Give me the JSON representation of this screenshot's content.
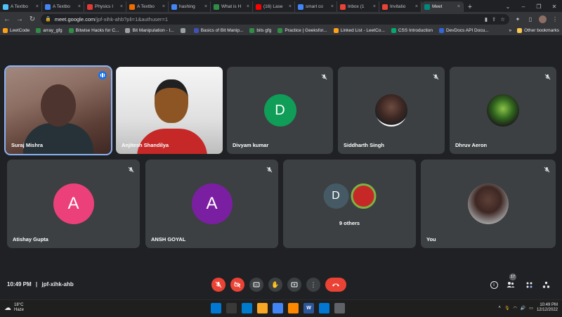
{
  "browser": {
    "tabs": [
      {
        "label": "A Textbo",
        "color": "#4fc3f7"
      },
      {
        "label": "A Textbo",
        "color": "#4285f4"
      },
      {
        "label": "Physics I",
        "color": "#e53935"
      },
      {
        "label": "A Textbo",
        "color": "#ef6c00"
      },
      {
        "label": "hashing",
        "color": "#4285f4"
      },
      {
        "label": "What is H",
        "color": "#2f8d46"
      },
      {
        "label": "(16) Lase",
        "color": "#ff0000"
      },
      {
        "label": "smart co",
        "color": "#4285f4"
      },
      {
        "label": "Inbox (1",
        "color": "#ea4335"
      },
      {
        "label": "Invitatio",
        "color": "#ea4335"
      },
      {
        "label": "Meet",
        "color": "#00897b"
      }
    ],
    "new_tab": "+",
    "window_controls": [
      "⌄",
      "–",
      "❐",
      "✕"
    ],
    "address": {
      "host": "meet.google.com",
      "path": "/jpf-xihk-ahb?pli=1&authuser=1"
    },
    "bookmarks": [
      {
        "label": "LeetCode",
        "color": "#ffa116"
      },
      {
        "label": "array_gfg",
        "color": "#2f8d46"
      },
      {
        "label": "Bitwise Hacks for C...",
        "color": "#2f8d46"
      },
      {
        "label": "Bit Manipulation - I...",
        "color": "#9aa0a6"
      },
      {
        "label": "",
        "color": "#9aa0a6"
      },
      {
        "label": "Basics of Bit Manip...",
        "color": "#3f51b5"
      },
      {
        "label": "bits gfg",
        "color": "#2f8d46"
      },
      {
        "label": "Practice | Geeksfor...",
        "color": "#2f8d46"
      },
      {
        "label": "Linked List - LeetCo...",
        "color": "#ffa116"
      },
      {
        "label": "CSS Introduction",
        "color": "#04aa6d"
      },
      {
        "label": "DevDocs API Docu...",
        "color": "#3367d6"
      }
    ],
    "bookmarks_more": "»",
    "other_bookmarks": "Other bookmarks"
  },
  "meet": {
    "participants": [
      {
        "name": "Suraj Mishra",
        "type": "video",
        "speaking": true
      },
      {
        "name": "Anjitesh Shandilya",
        "type": "video"
      },
      {
        "name": "Divyam kumar",
        "type": "letter",
        "letter": "D",
        "color": "#0f9d58",
        "muted": true
      },
      {
        "name": "Siddharth Singh",
        "type": "photo",
        "muted": true
      },
      {
        "name": "Dhruv Aeron",
        "type": "photo",
        "muted": true
      },
      {
        "name": "Atishay Gupta",
        "type": "letter",
        "letter": "A",
        "color": "#ec407a",
        "muted": true
      },
      {
        "name": "ANSH GOYAL",
        "type": "letter",
        "letter": "A",
        "color": "#7b1fa2",
        "muted": true
      },
      {
        "name": "",
        "type": "others",
        "others_label": "9 others",
        "letter": "D"
      },
      {
        "name": "You",
        "type": "photo",
        "muted": true
      }
    ],
    "time": "10:49 PM",
    "separator": "|",
    "code": "jpf-xihk-ahb",
    "participants_count": "17"
  },
  "taskbar": {
    "weather_temp": "18°C",
    "weather_desc": "Haze",
    "clock_time": "10:49 PM",
    "clock_date": "12/12/2022",
    "apps": [
      {
        "label": "",
        "color": "#0078d4",
        "icon": "windows-icon"
      },
      {
        "label": "",
        "color": "#3a3a3a",
        "icon": "search-icon"
      },
      {
        "label": "",
        "color": "#007acc",
        "icon": "vscode-icon"
      },
      {
        "label": "",
        "color": "#f9a825",
        "icon": "folder-icon"
      },
      {
        "label": "",
        "color": "#4285f4",
        "icon": "chrome-icon"
      },
      {
        "label": "",
        "color": "#ff8800",
        "icon": "vlc-icon"
      },
      {
        "label": "W",
        "color": "#2b579a",
        "icon": "word-icon"
      },
      {
        "label": "",
        "color": "#0078d4",
        "icon": "edge-icon"
      },
      {
        "label": "",
        "color": "#5f6368",
        "icon": "app-icon"
      }
    ]
  }
}
